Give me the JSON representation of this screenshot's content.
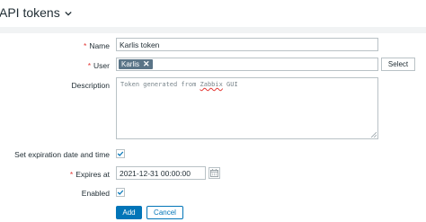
{
  "page": {
    "title": "API tokens"
  },
  "form": {
    "name": {
      "label": "Name",
      "required": true,
      "value": "Karlis token"
    },
    "user": {
      "label": "User",
      "required": true,
      "tags": [
        "Karlis"
      ],
      "select_label": "Select"
    },
    "description": {
      "label": "Description",
      "value_before": "Token generated from ",
      "value_misspelled": "Zabbix",
      "value_after": " GUI"
    },
    "expiration": {
      "label": "Set expiration date and time",
      "checked": true
    },
    "expires_at": {
      "label": "Expires at",
      "required": true,
      "value": "2021-12-31 00:00:00"
    },
    "enabled": {
      "label": "Enabled",
      "checked": true
    },
    "add_label": "Add",
    "cancel_label": "Cancel"
  },
  "colors": {
    "accent": "#0275b8",
    "required_marker": "#e33734",
    "tag_bg": "#5a7487",
    "border": "#b9c2c6"
  },
  "icons": {
    "title_chevron": "chevron-down-icon",
    "tag_remove": "close-icon",
    "calendar": "calendar-icon",
    "checkmark": "check-icon"
  }
}
